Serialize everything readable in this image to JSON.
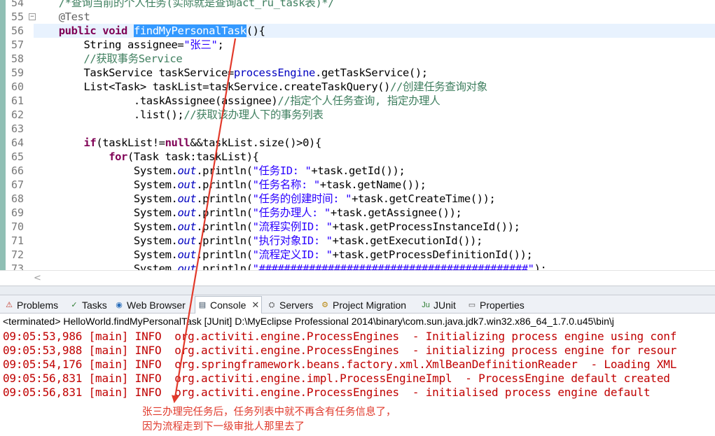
{
  "editor": {
    "lines": [
      {
        "no": "54",
        "faded": true,
        "current": false,
        "fold": false,
        "segments": [
          {
            "t": "    /*查询当前的个人任务(实际就是查询act_ru_task表)*/",
            "c": "cmt"
          }
        ]
      },
      {
        "no": "55",
        "faded": false,
        "current": false,
        "fold": true,
        "segments": [
          {
            "t": "    ",
            "c": ""
          },
          {
            "t": "@Test",
            "c": "ann"
          }
        ]
      },
      {
        "no": "56",
        "faded": false,
        "current": true,
        "fold": false,
        "segments": [
          {
            "t": "    ",
            "c": ""
          },
          {
            "t": "public",
            "c": "kw"
          },
          {
            "t": " ",
            "c": ""
          },
          {
            "t": "void",
            "c": "kw"
          },
          {
            "t": " ",
            "c": ""
          },
          {
            "t": "findMyPersonalTask",
            "c": "sel"
          },
          {
            "t": "(){",
            "c": ""
          }
        ]
      },
      {
        "no": "57",
        "faded": false,
        "current": false,
        "fold": false,
        "segments": [
          {
            "t": "        String assignee=",
            "c": ""
          },
          {
            "t": "\"张三\"",
            "c": "str"
          },
          {
            "t": ";",
            "c": ""
          }
        ]
      },
      {
        "no": "58",
        "faded": false,
        "current": false,
        "fold": false,
        "segments": [
          {
            "t": "        ",
            "c": ""
          },
          {
            "t": "//获取事务Service",
            "c": "cmt"
          }
        ]
      },
      {
        "no": "59",
        "faded": false,
        "current": false,
        "fold": false,
        "segments": [
          {
            "t": "        TaskService taskService=",
            "c": ""
          },
          {
            "t": "processEngine",
            "c": "fld"
          },
          {
            "t": ".getTaskService();",
            "c": ""
          }
        ]
      },
      {
        "no": "60",
        "faded": false,
        "current": false,
        "fold": false,
        "segments": [
          {
            "t": "        List<Task> taskList=taskService.createTaskQuery()",
            "c": ""
          },
          {
            "t": "//创建任务查询对象",
            "c": "cmt"
          }
        ]
      },
      {
        "no": "61",
        "faded": false,
        "current": false,
        "fold": false,
        "segments": [
          {
            "t": "                .taskAssignee(assignee)",
            "c": ""
          },
          {
            "t": "//指定个人任务查询, 指定办理人",
            "c": "cmt"
          }
        ]
      },
      {
        "no": "62",
        "faded": false,
        "current": false,
        "fold": false,
        "segments": [
          {
            "t": "                .list();",
            "c": ""
          },
          {
            "t": "//获取该办理人下的事务列表",
            "c": "cmt"
          }
        ]
      },
      {
        "no": "63",
        "faded": false,
        "current": false,
        "fold": false,
        "segments": [
          {
            "t": "",
            "c": ""
          }
        ]
      },
      {
        "no": "64",
        "faded": false,
        "current": false,
        "fold": false,
        "segments": [
          {
            "t": "        ",
            "c": ""
          },
          {
            "t": "if",
            "c": "kw"
          },
          {
            "t": "(taskList!=",
            "c": ""
          },
          {
            "t": "null",
            "c": "kw"
          },
          {
            "t": "&&taskList.size()>0){",
            "c": ""
          }
        ]
      },
      {
        "no": "65",
        "faded": false,
        "current": false,
        "fold": false,
        "segments": [
          {
            "t": "            ",
            "c": ""
          },
          {
            "t": "for",
            "c": "kw"
          },
          {
            "t": "(Task task:taskList){",
            "c": ""
          }
        ]
      },
      {
        "no": "66",
        "faded": false,
        "current": false,
        "fold": false,
        "segments": [
          {
            "t": "                System.",
            "c": ""
          },
          {
            "t": "out",
            "c": "sfld"
          },
          {
            "t": ".println(",
            "c": ""
          },
          {
            "t": "\"任务ID: \"",
            "c": "str"
          },
          {
            "t": "+task.getId());",
            "c": ""
          }
        ]
      },
      {
        "no": "67",
        "faded": false,
        "current": false,
        "fold": false,
        "segments": [
          {
            "t": "                System.",
            "c": ""
          },
          {
            "t": "out",
            "c": "sfld"
          },
          {
            "t": ".println(",
            "c": ""
          },
          {
            "t": "\"任务名称: \"",
            "c": "str"
          },
          {
            "t": "+task.getName());",
            "c": ""
          }
        ]
      },
      {
        "no": "68",
        "faded": false,
        "current": false,
        "fold": false,
        "segments": [
          {
            "t": "                System.",
            "c": ""
          },
          {
            "t": "out",
            "c": "sfld"
          },
          {
            "t": ".println(",
            "c": ""
          },
          {
            "t": "\"任务的创建时间: \"",
            "c": "str"
          },
          {
            "t": "+task.getCreateTime());",
            "c": ""
          }
        ]
      },
      {
        "no": "69",
        "faded": false,
        "current": false,
        "fold": false,
        "segments": [
          {
            "t": "                System.",
            "c": ""
          },
          {
            "t": "out",
            "c": "sfld"
          },
          {
            "t": ".println(",
            "c": ""
          },
          {
            "t": "\"任务办理人: \"",
            "c": "str"
          },
          {
            "t": "+task.getAssignee());",
            "c": ""
          }
        ]
      },
      {
        "no": "70",
        "faded": false,
        "current": false,
        "fold": false,
        "segments": [
          {
            "t": "                System.",
            "c": ""
          },
          {
            "t": "out",
            "c": "sfld"
          },
          {
            "t": ".println(",
            "c": ""
          },
          {
            "t": "\"流程实例ID: \"",
            "c": "str"
          },
          {
            "t": "+task.getProcessInstanceId());",
            "c": ""
          }
        ]
      },
      {
        "no": "71",
        "faded": false,
        "current": false,
        "fold": false,
        "segments": [
          {
            "t": "                System.",
            "c": ""
          },
          {
            "t": "out",
            "c": "sfld"
          },
          {
            "t": ".println(",
            "c": ""
          },
          {
            "t": "\"执行对象ID: \"",
            "c": "str"
          },
          {
            "t": "+task.getExecutionId());",
            "c": ""
          }
        ]
      },
      {
        "no": "72",
        "faded": false,
        "current": false,
        "fold": false,
        "segments": [
          {
            "t": "                System.",
            "c": ""
          },
          {
            "t": "out",
            "c": "sfld"
          },
          {
            "t": ".println(",
            "c": ""
          },
          {
            "t": "\"流程定义ID: \"",
            "c": "str"
          },
          {
            "t": "+task.getProcessDefinitionId());",
            "c": ""
          }
        ]
      },
      {
        "no": "73",
        "faded": false,
        "current": false,
        "fold": false,
        "segments": [
          {
            "t": "                System.",
            "c": ""
          },
          {
            "t": "out",
            "c": "sfld"
          },
          {
            "t": ".println(",
            "c": ""
          },
          {
            "t": "\"###########################################\"",
            "c": "str"
          },
          {
            "t": ");",
            "c": ""
          }
        ]
      }
    ],
    "scroll_arrow": "<"
  },
  "tabs": [
    {
      "name": "problems",
      "label": "Problems",
      "icon": "problems-icon",
      "glyph": "⚠",
      "color": "#c0392b",
      "active": false
    },
    {
      "name": "tasks",
      "label": "Tasks",
      "icon": "tasks-icon",
      "glyph": "✓",
      "color": "#2e7d32",
      "active": false
    },
    {
      "name": "web-browser",
      "label": "Web Browser",
      "icon": "globe-icon",
      "glyph": "◉",
      "color": "#2a6ebb",
      "active": false
    },
    {
      "name": "console",
      "label": "Console",
      "icon": "console-icon",
      "glyph": "▤",
      "color": "#34495e",
      "active": true
    },
    {
      "name": "servers",
      "label": "Servers",
      "icon": "servers-icon",
      "glyph": "⛭",
      "color": "#555555",
      "active": false
    },
    {
      "name": "project-migration",
      "label": "Project Migration",
      "icon": "migration-icon",
      "glyph": "⚙",
      "color": "#b8860b",
      "active": false
    },
    {
      "name": "junit",
      "label": "JUnit",
      "icon": "junit-icon",
      "glyph": "Ju",
      "color": "#2e7d32",
      "active": false
    },
    {
      "name": "properties",
      "label": "Properties",
      "icon": "properties-icon",
      "glyph": "▭",
      "color": "#555555",
      "active": false
    }
  ],
  "console": {
    "status": "<terminated> HelloWorld.findMyPersonalTask [JUnit] D:\\MyEclipse Professional 2014\\binary\\com.sun.java.jdk7.win32.x86_64_1.7.0.u45\\bin\\j",
    "lines": [
      "09:05:53,986 [main] INFO  org.activiti.engine.ProcessEngines  - Initializing process engine using conf",
      "09:05:53,988 [main] INFO  org.activiti.engine.ProcessEngines  - initializing process engine for resour",
      "09:05:54,176 [main] INFO  org.springframework.beans.factory.xml.XmlBeanDefinitionReader  - Loading XML",
      "09:05:56,831 [main] INFO  org.activiti.engine.impl.ProcessEngineImpl  - ProcessEngine default created",
      "09:05:56,831 [main] INFO  org.activiti.engine.ProcessEngines  - initialised process engine default"
    ]
  },
  "annotation": {
    "lines": [
      "张三办理完任务后，任务列表中就不再含有任务信息了，",
      "因为流程走到下一级审批人那里去了"
    ],
    "color": "#e0392b"
  }
}
